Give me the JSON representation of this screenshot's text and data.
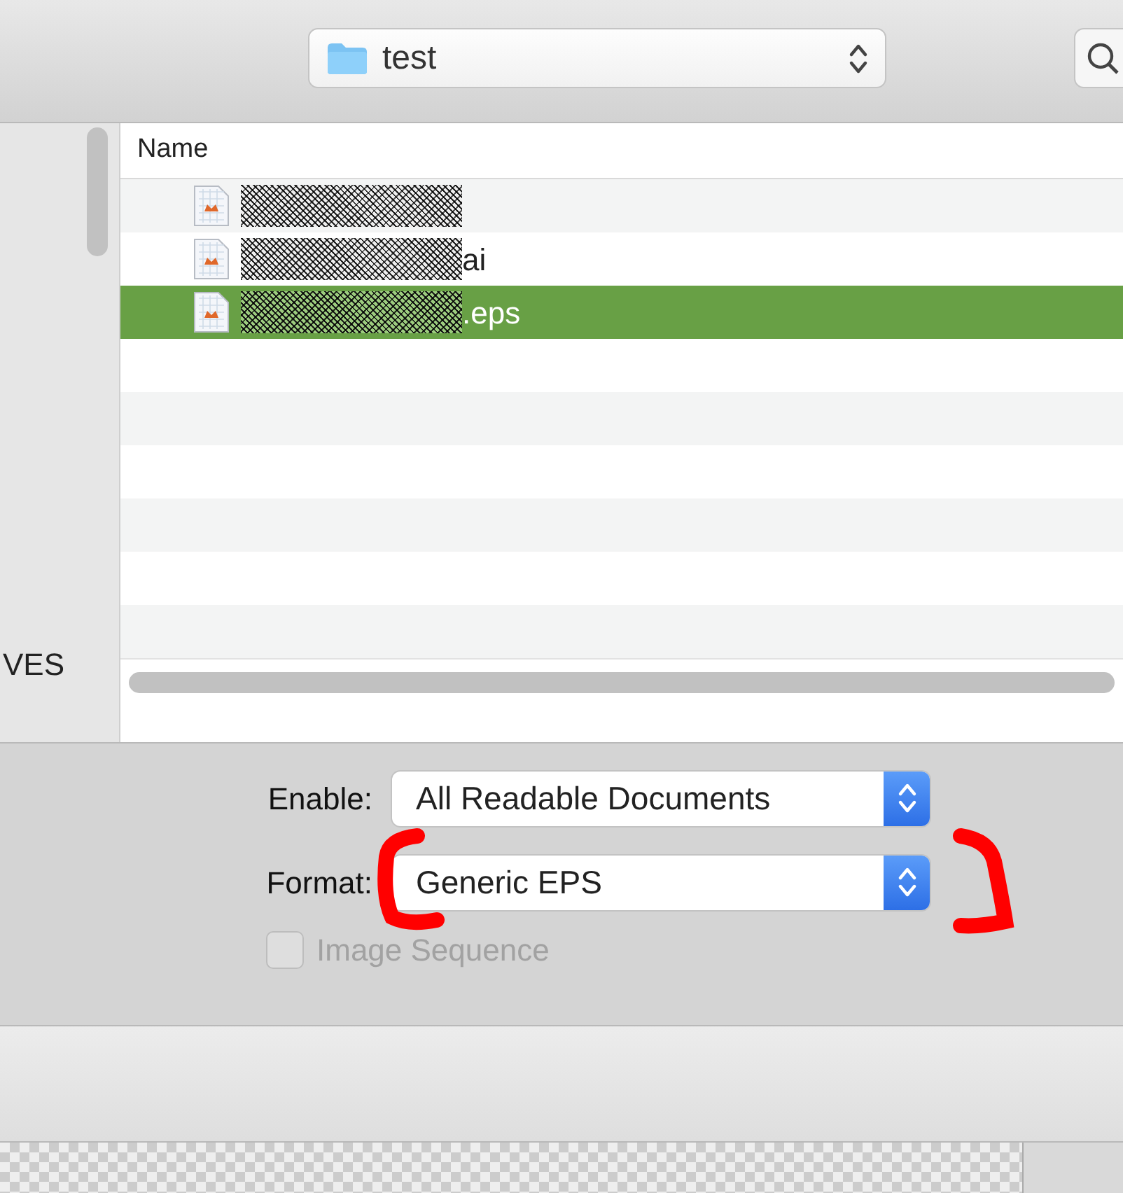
{
  "toolbar": {
    "location": "test"
  },
  "sidebar": {
    "partial_text": "VES"
  },
  "file_list": {
    "columns": [
      "Name"
    ],
    "rows": [
      {
        "name_tail": null,
        "selected": false,
        "redacted": true
      },
      {
        "name_tail": "ai",
        "selected": false,
        "redacted": true
      },
      {
        "name_tail": ".eps",
        "selected": true,
        "redacted": true
      }
    ]
  },
  "options": {
    "enable": {
      "label": "Enable:",
      "value": "All Readable Documents"
    },
    "format": {
      "label": "Format:",
      "value": "Generic EPS"
    },
    "image_sequence": {
      "label": "Image Sequence",
      "checked": false,
      "disabled": true
    }
  },
  "annotation": {
    "kind": "brackets"
  }
}
